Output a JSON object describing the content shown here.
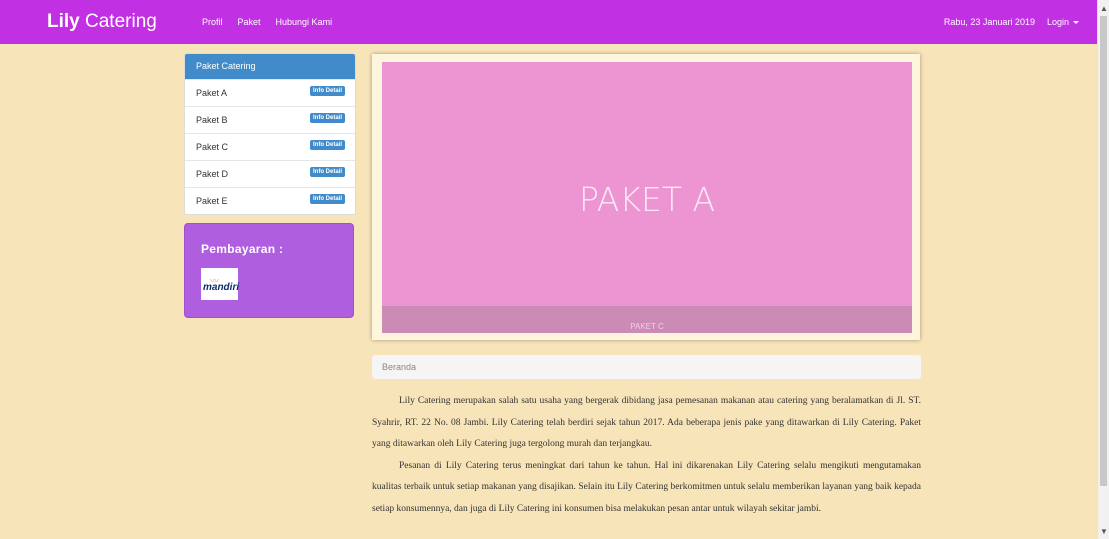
{
  "navbar": {
    "brand_bold": "Lily",
    "brand_rest": "Catering",
    "links": [
      "Profil",
      "Paket",
      "Hubungi Kami"
    ],
    "date": "Rabu, 23 Januari 2019",
    "login": "Login"
  },
  "sidebar": {
    "heading": "Paket Catering",
    "items": [
      {
        "label": "Paket A",
        "button": "Info Detail"
      },
      {
        "label": "Paket B",
        "button": "Info Detail"
      },
      {
        "label": "Paket C",
        "button": "Info Detail"
      },
      {
        "label": "Paket D",
        "button": "Info Detail"
      },
      {
        "label": "Paket E",
        "button": "Info Detail"
      }
    ]
  },
  "payment": {
    "title": "Pembayaran :",
    "bank_logo_text": "mandiri"
  },
  "carousel": {
    "slide_title": "PAKET A",
    "caption": "PAKET C"
  },
  "breadcrumb": "Beranda",
  "content": {
    "paragraph1": "Lily Catering merupakan salah satu usaha yang bergerak dibidang jasa pemesanan makanan atau catering yang beralamatkan di Jl. ST. Syahrir, RT. 22 No. 08 Jambi. Lily Catering telah berdiri sejak tahun 2017. Ada beberapa jenis pake yang ditawarkan di Lily Catering. Paket yang ditawarkan oleh Lily Catering juga tergolong murah dan terjangkau.",
    "paragraph2": "Pesanan di Lily Catering terus meningkat dari tahun ke tahun. Hal ini dikarenakan Lily Catering selalu mengikuti mengutamakan kualitas terbaik untuk setiap makanan yang disajikan. Selain itu Lily Catering berkomitmen untuk selalu memberikan layanan yang baik kepada setiap konsumennya, dan juga di Lily Catering ini konsumen bisa melakukan pesan antar untuk wilayah sekitar jambi."
  },
  "colors": {
    "navbar": "#c230e3",
    "background": "#f8e4b9",
    "panel_header": "#428bca",
    "payment_box": "#b05ee0",
    "slide": "#ec95d2"
  }
}
